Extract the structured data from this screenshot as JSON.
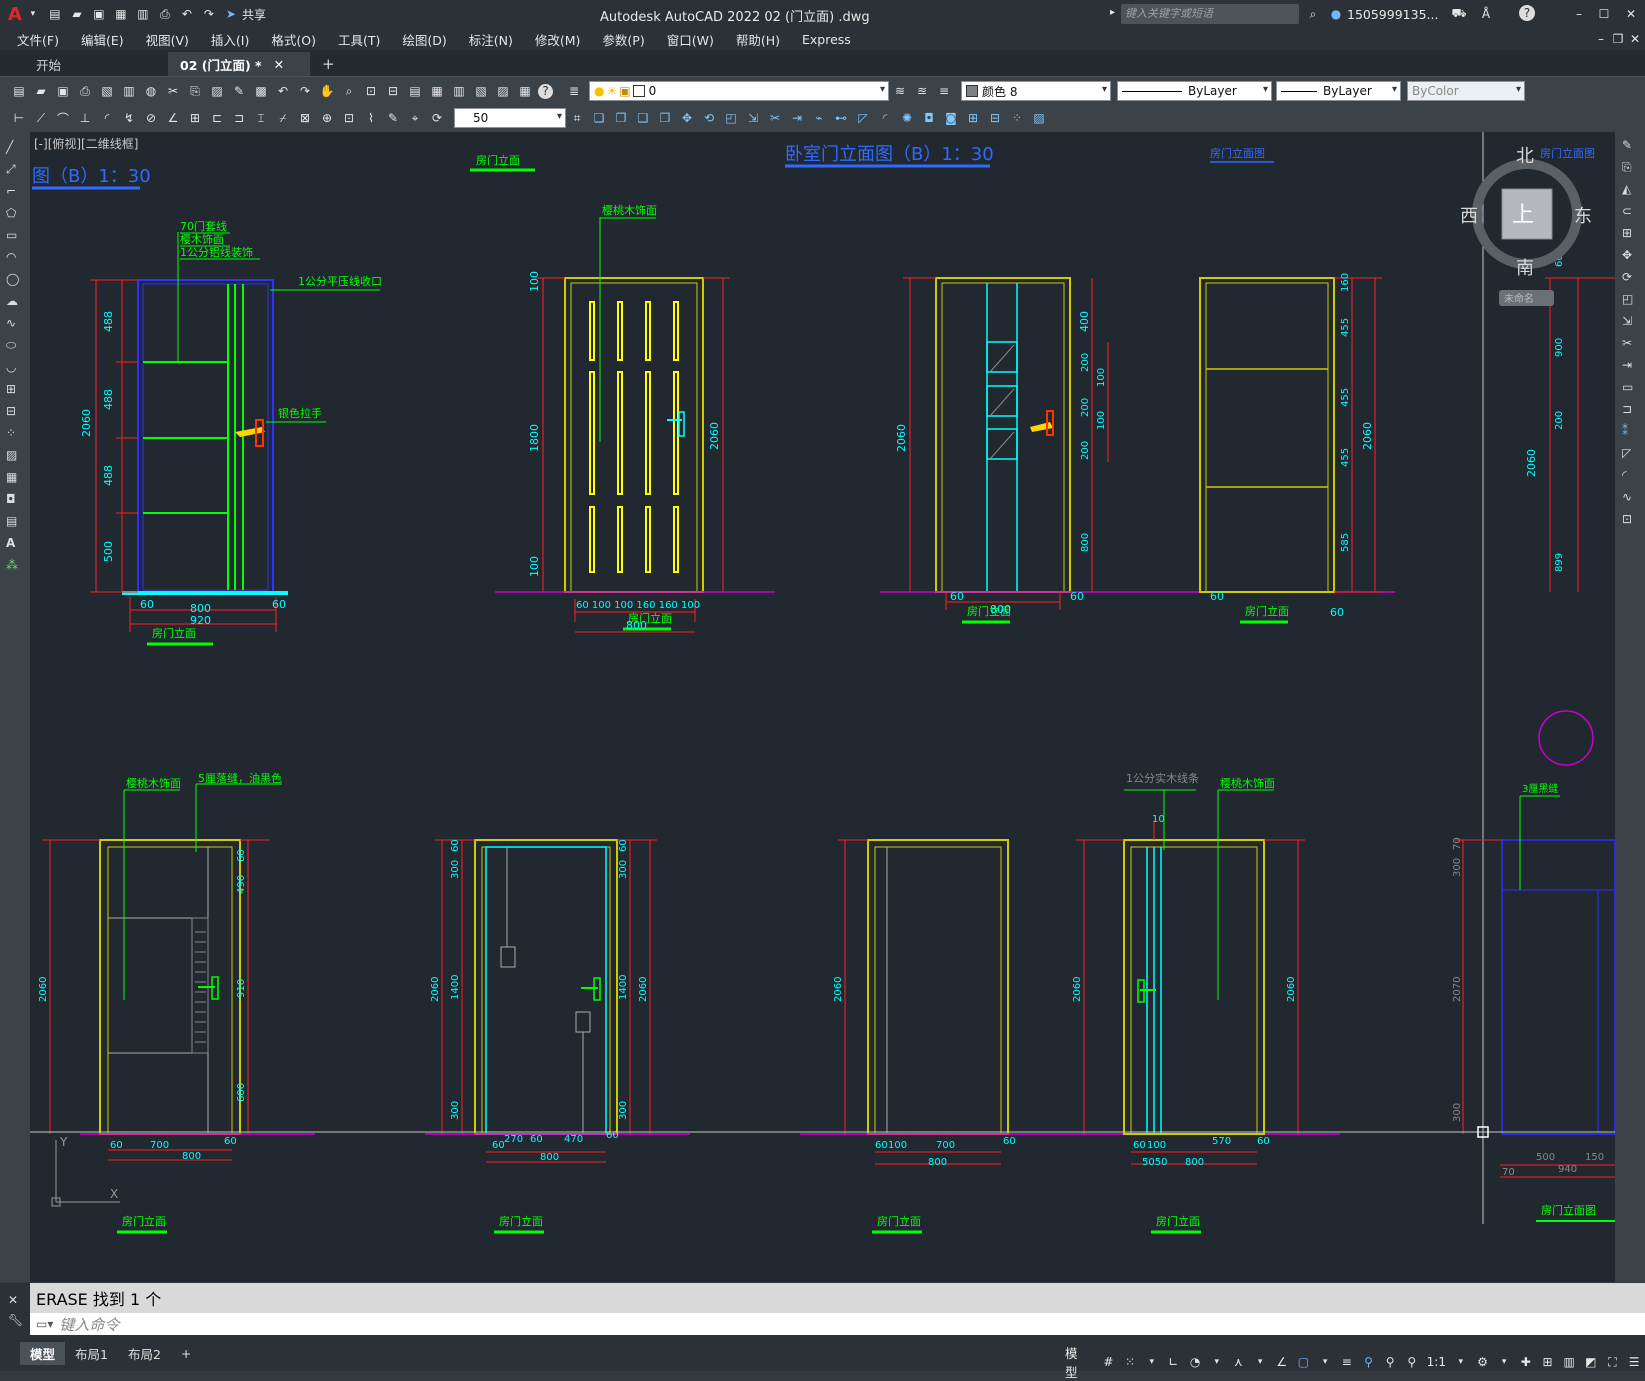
{
  "app": {
    "title": "Autodesk AutoCAD 2022    02 (门立面) .dwg",
    "search_placeholder": "键入关键字或短语",
    "user": "1505999135...",
    "share": "共享"
  },
  "menu": [
    "文件(F)",
    "编辑(E)",
    "视图(V)",
    "插入(I)",
    "格式(O)",
    "工具(T)",
    "绘图(D)",
    "标注(N)",
    "修改(M)",
    "参数(P)",
    "窗口(W)",
    "帮助(H)",
    "Express"
  ],
  "tabs": {
    "start": "开始",
    "doc": "02 (门立面) *",
    "close": "✕",
    "add": "+"
  },
  "toolbar": {
    "layer": "0",
    "color": "颜色 8",
    "linetype": "ByLayer",
    "lineweight": "ByLayer",
    "plotstyle": "ByColor",
    "scale": "50"
  },
  "viewport": {
    "label": "[-][俯视][二维线框]"
  },
  "viewcube": {
    "north": "北",
    "south": "南",
    "east": "东",
    "west": "西",
    "top": "上",
    "wcs": "未命名"
  },
  "drawing": {
    "title_left": "图（B）1：30",
    "title_center": "卧室门立面图（B）1：30",
    "title_right": "房门立面图",
    "title_far_right": "房门立面图",
    "door_label": "房门立面",
    "notes": {
      "n1": "70门套线",
      "n2": "樱木饰面",
      "n3": "1公分铝线装饰",
      "n4": "1公分平压线收口",
      "n5": "银色拉手",
      "n6": "樱桃木饰面",
      "n7": "5厘落缝，油黑色",
      "n8": "1公分实木线条",
      "n9": "樱桃木饰面",
      "n10": "3厘黑缝"
    },
    "dims": {
      "d2060": "2060",
      "d488": "488",
      "d500": "500",
      "d60": "60",
      "d800": "800",
      "d920": "920",
      "d1800": "1800",
      "d100": "100",
      "d160": "160",
      "d400": "400",
      "d200": "200",
      "d455": "455",
      "d585": "585",
      "d900": "900",
      "d899": "899",
      "d700": "700",
      "d10": "10",
      "d300": "300",
      "d1400": "1400",
      "d270": "270",
      "d470": "470",
      "d570": "570",
      "d5050": "5050",
      "d70": "70",
      "d2070": "2070",
      "d940": "940",
      "d150": "150",
      "d910": "910",
      "d600": "600",
      "d490": "490",
      "d6060": "60 100 100 160 160 100"
    }
  },
  "command": {
    "history": "ERASE  找到  1  个",
    "placeholder": "键入命令"
  },
  "layouts": [
    "模型",
    "布局1",
    "布局2"
  ],
  "status": {
    "model": "模型",
    "scale": "1:1"
  }
}
